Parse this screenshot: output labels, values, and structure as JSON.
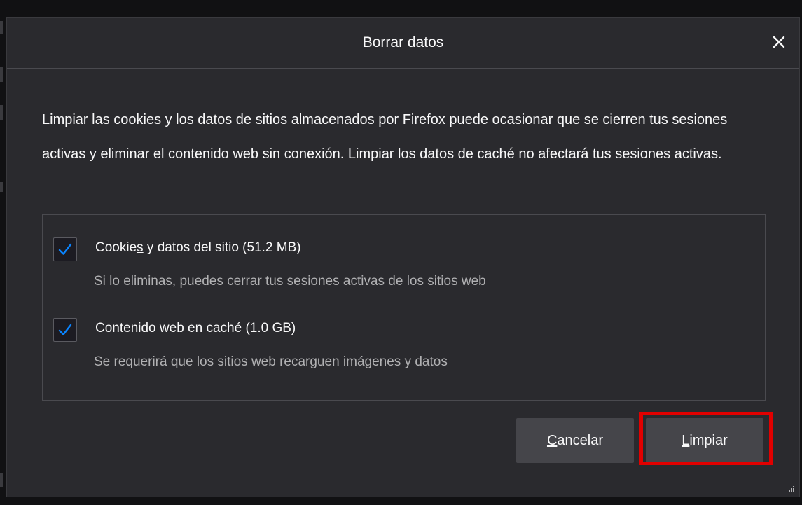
{
  "dialog": {
    "title": "Borrar datos",
    "description": "Limpiar las cookies y los datos de sitios almacenados por Firefox puede ocasionar que se cierren tus sesiones activas y eliminar el contenido web sin conexión. Limpiar los datos de caché no afectará tus sesiones activas.",
    "options": [
      {
        "label_pre": "Cookie",
        "label_key": "s",
        "label_post": " y datos del sitio (51.2 MB)",
        "sublabel": "Si lo eliminas, puedes cerrar tus sesiones activas de los sitios web",
        "checked": true
      },
      {
        "label_pre": "Contenido ",
        "label_key": "w",
        "label_post": "eb en caché (1.0 GB)",
        "sublabel": "Se requerirá que los sitios web recarguen imágenes y datos",
        "checked": true
      }
    ],
    "buttons": {
      "cancel_key": "C",
      "cancel_rest": "ancelar",
      "clear_key": "L",
      "clear_rest": "impiar"
    }
  },
  "icons": {
    "close": "close-icon",
    "checkmark": "checkmark-icon",
    "resize": "resize-grip-icon"
  },
  "colors": {
    "dialog_bg": "#2a2a2e",
    "text": "#f9f9fa",
    "subtext": "#b1b1b3",
    "check_accent": "#0a84ff",
    "highlight": "#e10000",
    "button_bg": "#45454a"
  }
}
